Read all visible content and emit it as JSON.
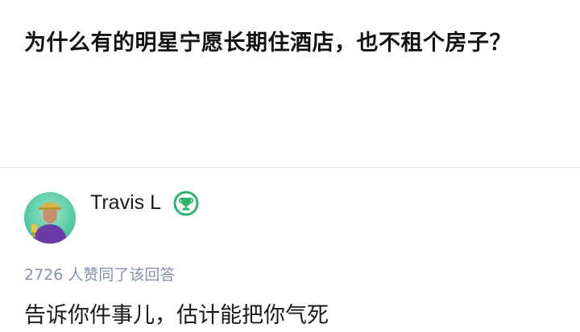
{
  "question": {
    "title": "为什么有的明星宁愿长期住酒店，也不租个房子？"
  },
  "answer": {
    "author": {
      "name": "Travis L",
      "avatar_icon": "avatar-person-photo",
      "badge_icon": "trophy-badge-icon"
    },
    "vote_text": "2726 人赞同了该回答",
    "content_first_line": "告诉你件事儿，估计能把你气死"
  },
  "colors": {
    "title": "#121212",
    "meta": "#8590a6",
    "badge": "#2db46d",
    "divider": "#e6e6e6"
  }
}
